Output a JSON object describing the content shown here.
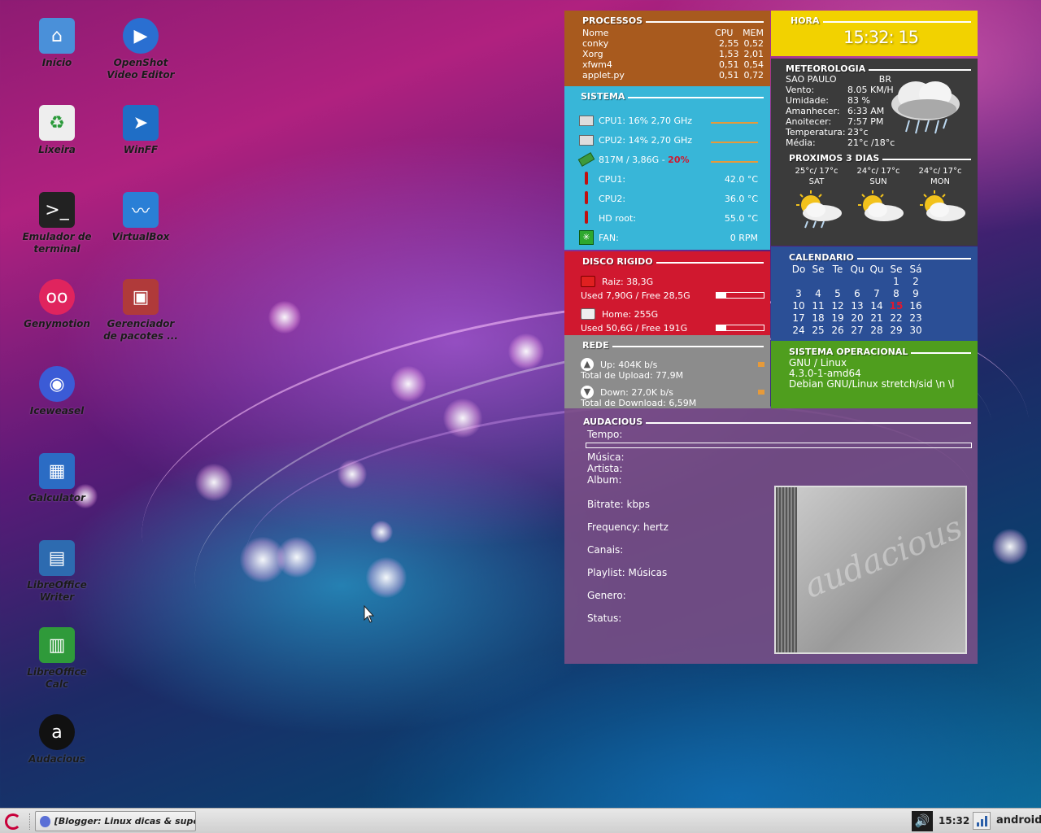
{
  "desktop_icons": [
    {
      "id": "inicio",
      "label": "Início",
      "icon": "home-folder-icon",
      "color": "#4a90d9"
    },
    {
      "id": "openshot",
      "label": "OpenShot Video Editor",
      "icon": "play-icon",
      "color": "#2a6fd1"
    },
    {
      "id": "lixeira",
      "label": "Lixeira",
      "icon": "trash-icon",
      "color": "#eeeeee"
    },
    {
      "id": "winff",
      "label": "WinFF",
      "icon": "video-convert-icon",
      "color": "#1f6ec6"
    },
    {
      "id": "terminal",
      "label": "Emulador de terminal",
      "icon": "terminal-icon",
      "color": "#222222"
    },
    {
      "id": "virtualbox",
      "label": "VirtualBox",
      "icon": "virtualbox-icon",
      "color": "#2a7fd6"
    },
    {
      "id": "genymotion",
      "label": "Genymotion",
      "icon": "genymotion-icon",
      "color": "#e0245e"
    },
    {
      "id": "pacotes",
      "label": "Gerenciador de pacotes ...",
      "icon": "package-manager-icon",
      "color": "#b03a3a"
    },
    {
      "id": "iceweasel",
      "label": "Iceweasel",
      "icon": "iceweasel-icon",
      "color": "#3b5bd6"
    },
    {
      "id": "calculator",
      "label": "Galculator",
      "icon": "calculator-icon",
      "color": "#2b6cc4"
    },
    {
      "id": "writer",
      "label": "LibreOffice Writer",
      "icon": "libreoffice-writer-icon",
      "color": "#2d6bb0"
    },
    {
      "id": "calc",
      "label": "LibreOffice Calc",
      "icon": "libreoffice-calc-icon",
      "color": "#2f9a3a"
    },
    {
      "id": "audacious",
      "label": "Audacious",
      "icon": "audacious-icon",
      "color": "#111111"
    }
  ],
  "processos": {
    "title": "PROCESSOS",
    "header": {
      "name": "Nome",
      "cpu": "CPU",
      "mem": "MEM"
    },
    "rows": [
      {
        "name": "conky",
        "cpu": "2,55",
        "mem": "0,52"
      },
      {
        "name": "Xorg",
        "cpu": "1,53",
        "mem": "2,01"
      },
      {
        "name": "xfwm4",
        "cpu": "0,51",
        "mem": "0,54"
      },
      {
        "name": "applet.py",
        "cpu": "0,51",
        "mem": "0,72"
      }
    ],
    "color": "#a85a1e"
  },
  "hora": {
    "title": "HORA",
    "time": "15:32: 15",
    "color": "#f2d200"
  },
  "sistema": {
    "title": "SISTEMA",
    "cpu1": "CPU1: 16%  2,70 GHz",
    "cpu2": "CPU2: 14%  2,70 GHz",
    "mem": "817M / 3,86G - ",
    "mem_pct": "20%",
    "temps": [
      {
        "label": "CPU1:",
        "value": "42.0 °C"
      },
      {
        "label": "CPU2:",
        "value": "36.0 °C"
      },
      {
        "label": "HD root:",
        "value": "55.0 °C"
      },
      {
        "label": "FAN:",
        "value": "0  RPM"
      }
    ],
    "color": "#38b6d8"
  },
  "meteorologia": {
    "title": "METEOROLOGIA",
    "city": "SAO PAULO",
    "country": "BR",
    "rows": [
      {
        "label": "Vento:",
        "value": "8.05 KM/H"
      },
      {
        "label": "Umidade:",
        "value": "83 %"
      },
      {
        "label": "Amanhecer:",
        "value": "6:33 AM"
      },
      {
        "label": "Anoitecer:",
        "value": "7:57 PM"
      },
      {
        "label": "Temperatura:",
        "value": "23°c"
      },
      {
        "label": "Média:",
        "value": "21°c /18°c"
      }
    ],
    "forecast_title": "PROXIMOS 3 DIAS",
    "forecast": [
      {
        "temp": "25°c/ 17°c",
        "day": "SAT",
        "icon": "sun-cloud-rain-icon"
      },
      {
        "temp": "24°c/ 17°c",
        "day": "SUN",
        "icon": "sun-cloud-icon"
      },
      {
        "temp": "24°c/ 17°c",
        "day": "MON",
        "icon": "sun-cloud-icon"
      }
    ],
    "color": "#3b3b3b"
  },
  "disco": {
    "title": "DISCO RIGIDO",
    "raiz": "Raiz: 38,3G",
    "raiz_used": "Used 7,90G / Free 28,5G",
    "raiz_pct": 0.21,
    "home": "Home: 255G",
    "home_used": "Used 50,6G / Free 191G",
    "home_pct": 0.2,
    "color": "#d0182f"
  },
  "calendario": {
    "title": "CALENDARIO",
    "days": [
      "Do",
      "Se",
      "Te",
      "Qu",
      "Qu",
      "Se",
      "Sá"
    ],
    "weeks": [
      [
        "",
        "",
        "",
        "",
        "",
        "1",
        "2"
      ],
      [
        "3",
        "4",
        "5",
        "6",
        "7",
        "8",
        "9"
      ],
      [
        "10",
        "11",
        "12",
        "13",
        "14",
        "15",
        "16"
      ],
      [
        "17",
        "18",
        "19",
        "20",
        "21",
        "22",
        "23"
      ],
      [
        "24",
        "25",
        "26",
        "27",
        "28",
        "29",
        "30"
      ]
    ],
    "today": "15",
    "color": "#2b4f96"
  },
  "rede": {
    "title": "REDE",
    "up": "Up: 404K b/s",
    "up_total": "Total de Upload: 77,9M",
    "down": "Down: 27,0K b/s",
    "down_total": "Total de Download: 6,59M",
    "color": "#8c8c8c"
  },
  "sistema_operacional": {
    "title": "SISTEMA OPERACIONAL",
    "lines": [
      "GNU / Linux",
      "4.3.0-1-amd64",
      "Debian GNU/Linux stretch/sid \\n \\l"
    ],
    "color": "#4f9e1e"
  },
  "audacious": {
    "title": "AUDACIOUS",
    "tempo": "Tempo:",
    "musica": "Música:",
    "artista": "Artista:",
    "album": "Album:",
    "bitrate": "Bitrate:  kbps",
    "frequency": "Frequency:  hertz",
    "canais": "Canais:",
    "playlist": "Playlist:  Músicas",
    "genero": "Genero:",
    "status": "Status:",
    "cover_text": "audacious",
    "color": "#7b4f86"
  },
  "taskbar": {
    "window_title": "[Blogger: Linux dicas & supo...",
    "clock": "15:32",
    "user": "android"
  }
}
